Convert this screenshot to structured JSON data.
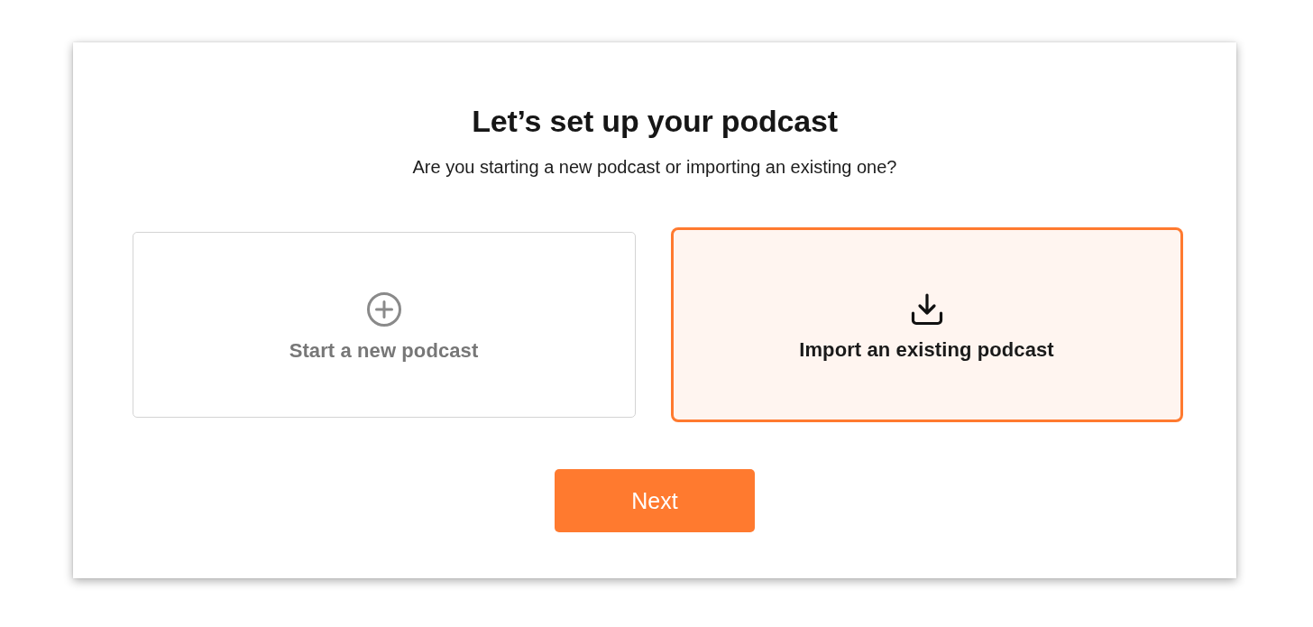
{
  "dialog": {
    "title": "Let’s set up your podcast",
    "subtitle": "Are you starting a new podcast or importing an existing one?"
  },
  "options": [
    {
      "kind": "new",
      "label": "Start a new podcast",
      "selected": false
    },
    {
      "kind": "import",
      "label": "Import an existing podcast",
      "selected": true
    }
  ],
  "next_button": {
    "label": "Next"
  }
}
